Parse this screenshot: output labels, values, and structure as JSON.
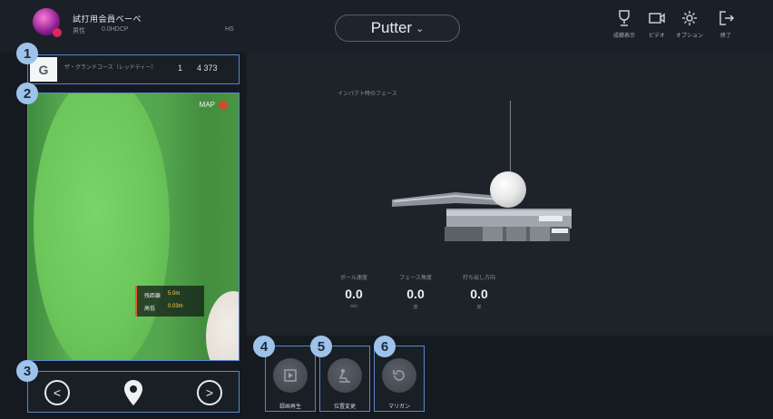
{
  "header": {
    "player_name": "試打用会員ベーべ",
    "player_meta": [
      "男性",
      "0.0HDCP",
      "HS"
    ],
    "club_label": "Putter",
    "toolbar": [
      {
        "icon": "trophy-icon",
        "label": "成績表示"
      },
      {
        "icon": "video-icon",
        "label": "ビデオ"
      },
      {
        "icon": "gear-icon",
        "label": "オプション"
      },
      {
        "icon": "exit-icon",
        "label": "終了"
      }
    ]
  },
  "hole_info": {
    "course_name": "ザ・グランドコース（レッドティー）",
    "hole": "1",
    "par_yards": "4 373"
  },
  "map": {
    "label": "MAP",
    "distance_rows": [
      {
        "label": "残距離",
        "value": "5.0m"
      },
      {
        "label": "高低",
        "value": "0.03m"
      }
    ]
  },
  "nav": {
    "prev": "<",
    "next": ">"
  },
  "club_panel": {
    "title": "インパクト時のフェース",
    "stats": [
      {
        "label": "ボール速度",
        "value": "0.0",
        "unit": "m/s"
      },
      {
        "label": "フェース角度",
        "value": "0.0",
        "unit": "度"
      },
      {
        "label": "打ち出し方向",
        "value": "0.0",
        "unit": "度"
      }
    ]
  },
  "functions": [
    {
      "icon": "replay-icon",
      "label": "録画再生"
    },
    {
      "icon": "golfer-icon",
      "label": "位置変更"
    },
    {
      "icon": "mulligan-icon",
      "label": "マリガン"
    }
  ],
  "callouts": [
    "1",
    "2",
    "3",
    "4",
    "5",
    "6"
  ],
  "colors": {
    "accent_border": "#5a86c8",
    "callout": "#9ec3ea",
    "background": "#151a21"
  }
}
